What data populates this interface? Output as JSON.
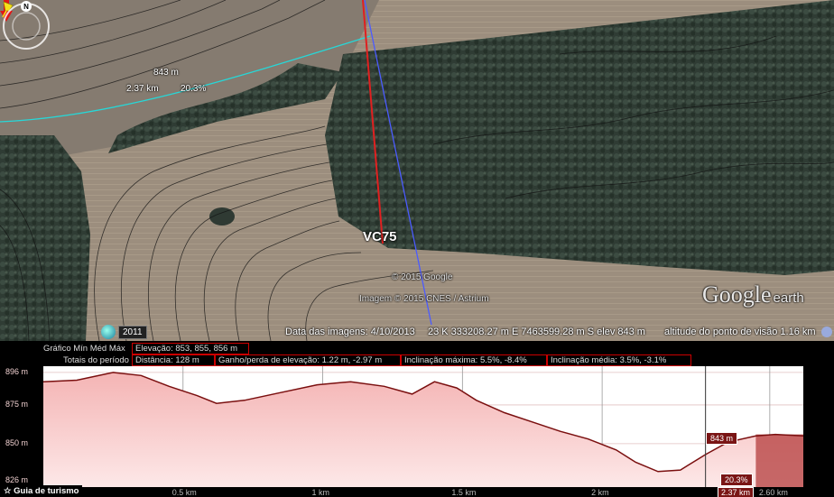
{
  "map": {
    "waypoint_label": "VC75",
    "copyright_google": "© 2015 Google",
    "copyright_imagery": "Imagem © 2015 CNES / Astrium",
    "logo": "Google",
    "logo_suffix": "earth",
    "compass_letter": "N",
    "pointer": {
      "elevation": "843 m",
      "distance": "2.37 km",
      "slope": "20.3%"
    }
  },
  "statusbar": {
    "history_year": "2011",
    "imagery_date": "Data das imagens: 4/10/2013",
    "coords": "23 K 333208.27 m E 7463599.28 m S  elev  843 m",
    "eye_alt": "altitude do ponto de visão  1.16 km"
  },
  "profile": {
    "row1_label": "Gráfico  Mín  Méd  Máx",
    "elevation_box": "Elevação: 853, 855, 856 m",
    "row2_label": "Totais do período",
    "distance_box": "Distância: 128 m",
    "gain_box": "Ganho/perda de elevação: 1.22 m, -2.97 m",
    "max_slope_box": "Inclinação máxima: 5.5%, -8.4%",
    "avg_slope_box": "Inclinação média: 3.5%, -3.1%",
    "guide_label": "☆ Guia de turismo",
    "cursor_elev_tag": "843 m",
    "cursor_slope_tag": "20.3%",
    "cursor_dist_tag": "2.37 km"
  },
  "chart_data": {
    "type": "area",
    "x": [
      0,
      0.12,
      0.25,
      0.35,
      0.45,
      0.55,
      0.62,
      0.72,
      0.85,
      0.98,
      1.1,
      1.22,
      1.32,
      1.4,
      1.48,
      1.55,
      1.65,
      1.75,
      1.85,
      1.95,
      2.05,
      2.12,
      2.2,
      2.28,
      2.37,
      2.45,
      2.55,
      2.62,
      2.72
    ],
    "y": [
      890,
      891,
      896,
      894,
      887,
      881,
      876,
      878,
      883,
      888,
      890,
      887,
      882,
      890,
      886,
      878,
      870,
      864,
      858,
      853,
      846,
      838,
      832,
      833,
      843,
      851,
      855,
      856,
      855
    ],
    "y_ticks": [
      "896 m",
      "875 m",
      "850 m",
      "826 m"
    ],
    "x_ticks": [
      "0.5 km",
      "1 km",
      "1.5 km",
      "2 km",
      "2.60 km"
    ],
    "ylim": [
      822,
      900
    ],
    "xlim": [
      0,
      2.72
    ],
    "cursor_x": 2.37,
    "selection_x": [
      2.55,
      2.72
    ],
    "grid": true,
    "colors": {
      "line": "#7a0f0f",
      "fill_top": "#f4b4b4",
      "fill_bottom": "#fde8e8"
    }
  }
}
